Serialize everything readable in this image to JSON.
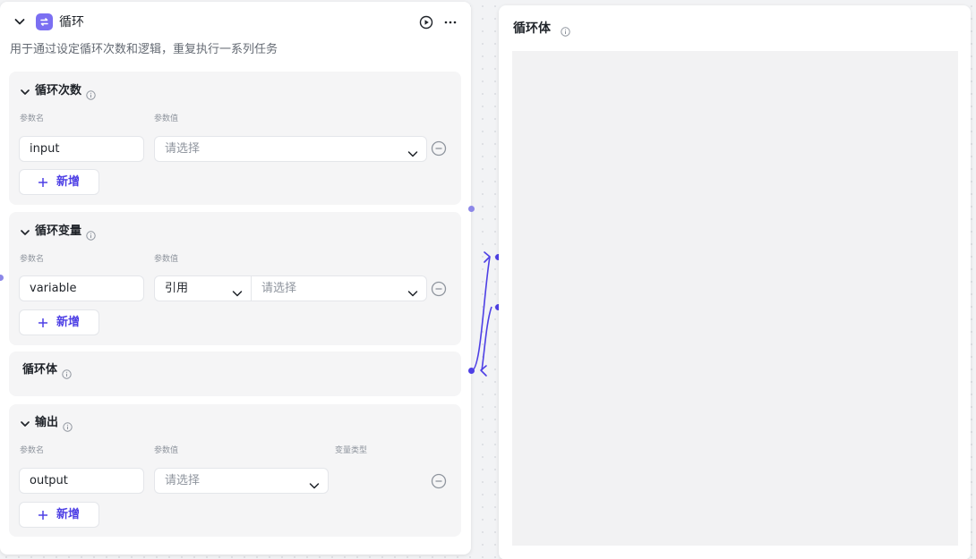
{
  "node": {
    "title": "循环",
    "description": "用于通过设定循环次数和逻辑，重复执行一系列任务",
    "accent": "#7b6ff2"
  },
  "sections": {
    "count": {
      "title": "循环次数",
      "param_name_label": "参数名",
      "param_value_label": "参数值",
      "name_value": "input",
      "value_placeholder": "请选择",
      "add_label": "新增"
    },
    "variables": {
      "title": "循环变量",
      "param_name_label": "参数名",
      "param_value_label": "参数值",
      "name_value": "variable",
      "mode_value": "引用",
      "value_placeholder": "请选择",
      "add_label": "新增"
    },
    "loop_body": {
      "title": "循环体"
    },
    "output": {
      "title": "输出",
      "param_name_label": "参数名",
      "param_value_label": "参数值",
      "type_label": "变量类型",
      "name_value": "output",
      "value_placeholder": "请选择",
      "add_label": "新增"
    }
  },
  "body_panel": {
    "title": "循环体"
  },
  "colors": {
    "brand": "#4e40e5",
    "connector": "#4e40e5"
  },
  "icons": [
    "chevron-down-icon",
    "loop-icon",
    "play-icon",
    "more-icon",
    "info-icon",
    "minus-circle-icon",
    "plus-icon"
  ]
}
